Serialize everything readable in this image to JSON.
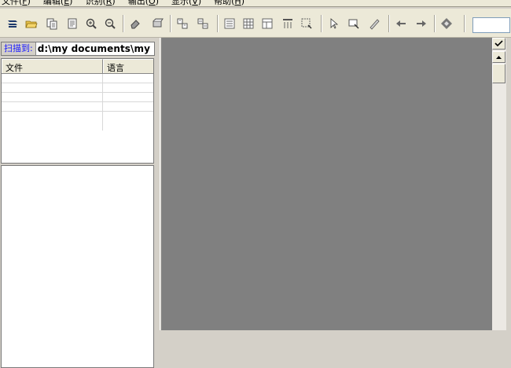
{
  "menubar": {
    "items": [
      {
        "label": "文件",
        "key": "F"
      },
      {
        "label": "编辑",
        "key": "E"
      },
      {
        "label": "识别",
        "key": "R"
      },
      {
        "label": "输出",
        "key": "O"
      },
      {
        "label": "显示",
        "key": "V"
      },
      {
        "label": "帮助",
        "key": "H"
      }
    ]
  },
  "scan": {
    "label": "扫描到:",
    "path": "d:\\my documents\\my h"
  },
  "file_table": {
    "columns": [
      "文件",
      "语言"
    ]
  },
  "toolbar": {
    "icons": [
      "scan-icon",
      "open-folder-icon",
      "copy-page-icon",
      "paste-page-icon",
      "zoom-in-icon",
      "zoom-out-icon",
      "eraser-icon",
      "rotate-icon",
      "layout-icon",
      "layout2-icon",
      "text-block-icon",
      "table-block-icon",
      "image-block-icon",
      "column-icon",
      "select-region-icon",
      "pointer-icon",
      "region-edit-icon",
      "pen-icon",
      "arrow-left-icon",
      "arrow-right-icon",
      "recognize-icon"
    ]
  },
  "colors": {
    "canvas": "#808080",
    "toolbar": "#ece9d8",
    "scan_label_text": "#1a1aff"
  }
}
